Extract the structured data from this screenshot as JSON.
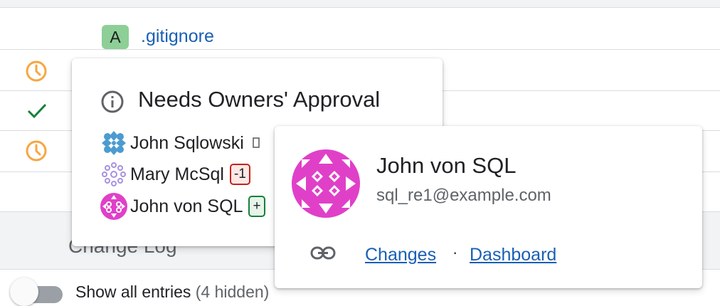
{
  "file": {
    "status_badge": "A",
    "name": ".gitignore"
  },
  "rows": [
    {
      "status_icon": "clock-icon"
    },
    {
      "status_icon": "check-icon"
    },
    {
      "status_icon": "clock-icon"
    }
  ],
  "change_log": {
    "title": "Change Log",
    "toggle_state": "off",
    "show_all_label": "Show all entries",
    "hidden_count": "(4 hidden)"
  },
  "approval_card": {
    "icon": "info-icon",
    "title": "Needs Owners' Approval",
    "owners": [
      {
        "name": "John Sqlowski",
        "vote": ""
      },
      {
        "name": "Mary McSql",
        "vote": "-1"
      },
      {
        "name": "John von SQL",
        "vote": "+"
      }
    ]
  },
  "user_card": {
    "name": "John von SQL",
    "email": "sql_re1@example.com",
    "link_icon": "link-icon",
    "changes_label": "Changes",
    "separator": "·",
    "dashboard_label": "Dashboard"
  },
  "colors": {
    "link": "#1a5fb4",
    "added_badge": "#8dcf97",
    "pending_clock": "#f5a742",
    "approved_check": "#188038",
    "negative_vote": "#c5221f",
    "positive_vote": "#188038",
    "avatar_magenta": "#e040c8",
    "avatar_blue": "#4c9bd0",
    "avatar_lavender": "#a890e0"
  }
}
